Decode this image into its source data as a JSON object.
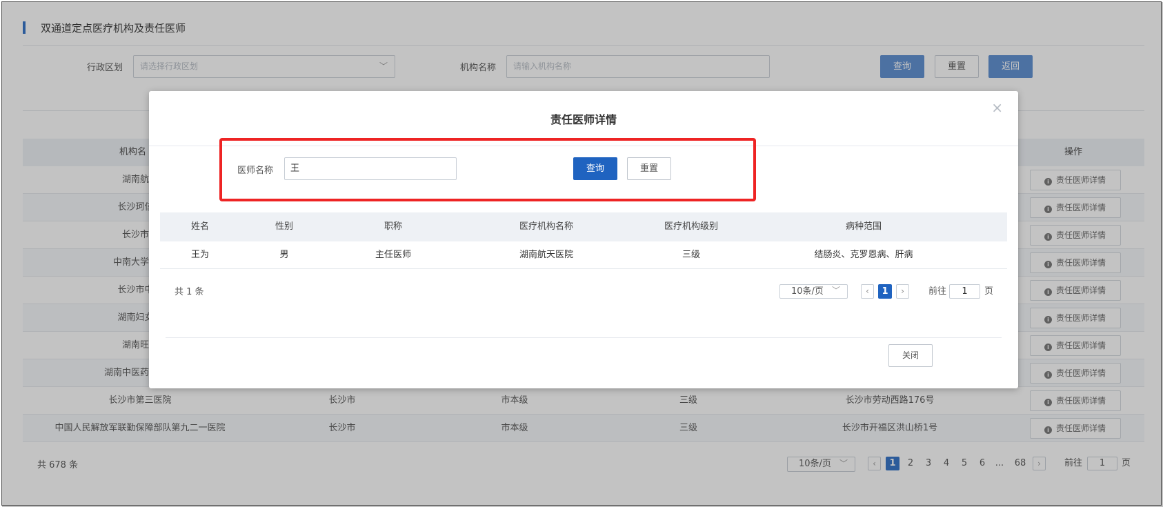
{
  "page": {
    "title": "双通道定点医疗机构及责任医师",
    "filters": {
      "region_label": "行政区划",
      "region_placeholder": "请选择行政区划",
      "org_label": "机构名称",
      "org_placeholder": "请输入机构名称",
      "query_label": "查询",
      "reset_label": "重置",
      "back_label": "返回"
    },
    "table": {
      "headers": [
        "机构名",
        "操作"
      ],
      "rows": [
        {
          "name": "湖南航天",
          "action": "责任医师详情"
        },
        {
          "name": "长沙珂信肿",
          "action": "责任医师详情"
        },
        {
          "name": "长沙市八",
          "action": "责任医师详情"
        },
        {
          "name": "中南大学湘雅",
          "action": "责任医师详情"
        },
        {
          "name": "长沙市中心",
          "action": "责任医师详情"
        },
        {
          "name": "湖南妇女儿",
          "action": "责任医师详情"
        },
        {
          "name": "湖南旺旺",
          "action": "责任医师详情"
        },
        {
          "name": "湖南中医药大学第",
          "action": "责任医师详情"
        },
        {
          "name": "长沙市第三医院",
          "city": "长沙市",
          "level": "市本级",
          "grade": "三级",
          "address": "长沙市劳动西路176号",
          "action": "责任医师详情"
        },
        {
          "name": "中国人民解放军联勤保障部队第九二一医院",
          "city": "长沙市",
          "level": "市本级",
          "grade": "三级",
          "address": "长沙市开福区洪山桥1号",
          "action": "责任医师详情"
        }
      ]
    },
    "pagination": {
      "total": "共 678 条",
      "page_size": "10条/页",
      "pages": [
        "1",
        "2",
        "3",
        "4",
        "5",
        "6",
        "...",
        "68"
      ],
      "goto_label": "前往",
      "goto_value": "1",
      "page_unit": "页"
    }
  },
  "modal": {
    "title": "责任医师详情",
    "close_icon": "×",
    "search": {
      "label": "医师名称",
      "value": "王",
      "query_label": "查询",
      "reset_label": "重置"
    },
    "table": {
      "headers": [
        "姓名",
        "性别",
        "职称",
        "医疗机构名称",
        "医疗机构级别",
        "病种范围"
      ],
      "rows": [
        {
          "name": "王为",
          "gender": "男",
          "title": "主任医师",
          "org": "湖南航天医院",
          "grade": "三级",
          "scope": "结肠炎、克罗恩病、肝病"
        }
      ]
    },
    "pagination": {
      "total": "共 1 条",
      "page_size": "10条/页",
      "current_page": "1",
      "goto_label": "前往",
      "goto_value": "1",
      "page_unit": "页"
    },
    "close_label": "关闭"
  },
  "colors": {
    "primary": "#1f63c0",
    "highlight": "#ee2424"
  }
}
